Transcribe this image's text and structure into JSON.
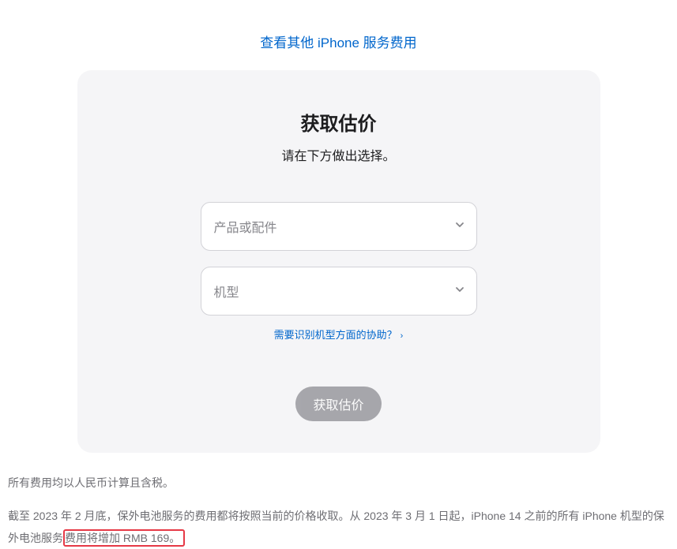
{
  "topLink": {
    "label": "查看其他 iPhone 服务费用"
  },
  "card": {
    "title": "获取估价",
    "subtitle": "请在下方做出选择。",
    "select1_placeholder": "产品或配件",
    "select2_placeholder": "机型",
    "helpLink": "需要识别机型方面的协助？",
    "submit_label": "获取估价"
  },
  "footer": {
    "line1": "所有费用均以人民币计算且含税。",
    "line2_prefix": "截至 2023 年 2 月底，保外电池服务的费用都将按照当前的价格收取。从 2023 年 3 月 1 日起，iPhone 14 之前的所有 iPhone 机型的保外电池服务",
    "line2_highlighted": "费用将增加 RMB 169。"
  }
}
